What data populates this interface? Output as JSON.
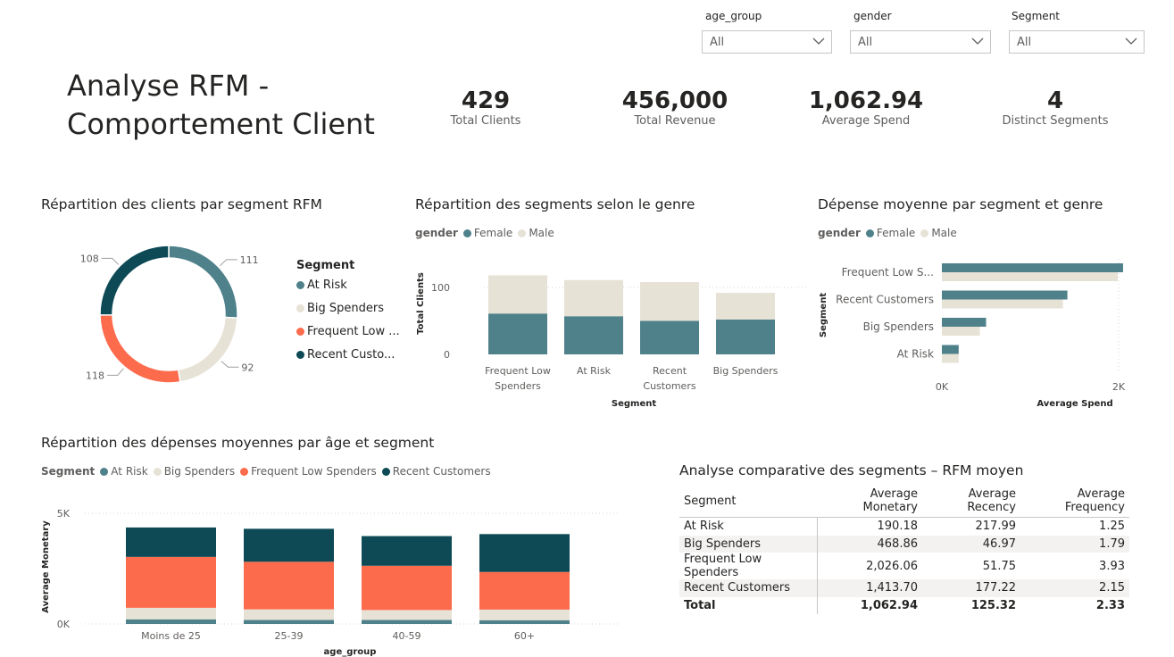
{
  "slicers": [
    {
      "label": "age_group",
      "value": "All"
    },
    {
      "label": "gender",
      "value": "All"
    },
    {
      "label": "Segment",
      "value": "All"
    }
  ],
  "title_line1": "Analyse RFM -",
  "title_line2": "Comportement Client",
  "kpis": [
    {
      "value": "429",
      "label": "Total Clients"
    },
    {
      "value": "456,000",
      "label": "Total Revenue"
    },
    {
      "value": "1,062.94",
      "label": "Average Spend"
    },
    {
      "value": "4",
      "label": "Distinct Segments"
    }
  ],
  "colors": {
    "at_risk": "#4f818b",
    "big_spenders": "#e6e2d6",
    "frequent_low": "#fd6b4d",
    "recent": "#0d4a56",
    "female": "#4f818b",
    "male": "#e6e2d6"
  },
  "donut": {
    "title": "Répartition des clients par segment RFM",
    "legend_title": "Segment",
    "legend_items": [
      "At Risk",
      "Big Spenders",
      "Frequent Low ...",
      "Recent Custo..."
    ]
  },
  "gender_bar": {
    "title": "Répartition des segments selon le genre",
    "legend_title": "gender",
    "legend_items": [
      "Female",
      "Male"
    ],
    "ylabel": "Total Clients",
    "xlabel": "Segment",
    "yticks": [
      "100",
      "0"
    ]
  },
  "spend_bar": {
    "title": "Dépense moyenne par segment et genre",
    "legend_title": "gender",
    "legend_items": [
      "Female",
      "Male"
    ],
    "ylabel": "Segment",
    "xlabel": "Average Spend",
    "xticks": [
      "0K",
      "2K"
    ]
  },
  "age_bar": {
    "title": "Répartition des dépenses moyennes par âge et segment",
    "legend_title": "Segment",
    "legend_items": [
      "At Risk",
      "Big Spenders",
      "Frequent Low Spenders",
      "Recent Customers"
    ],
    "ylabel": "Average Monetary",
    "xlabel": "age_group",
    "yticks": [
      "5K",
      "0K"
    ]
  },
  "table": {
    "title": "Analyse comparative des segments – RFM moyen",
    "headers": [
      "Segment",
      "Average Monetary",
      "Average Recency",
      "Average Frequency"
    ],
    "rows": [
      [
        "At Risk",
        "190.18",
        "217.99",
        "1.25"
      ],
      [
        "Big Spenders",
        "468.86",
        "46.97",
        "1.79"
      ],
      [
        "Frequent Low Spenders",
        "2,026.06",
        "51.75",
        "3.93"
      ],
      [
        "Recent Customers",
        "1,413.70",
        "177.22",
        "2.15"
      ]
    ],
    "total": [
      "Total",
      "1,062.94",
      "125.32",
      "2.33"
    ]
  },
  "chart_data": [
    {
      "type": "pie",
      "title": "Répartition des clients par segment RFM",
      "categories": [
        "At Risk",
        "Big Spenders",
        "Frequent Low Spenders",
        "Recent Customers"
      ],
      "values": [
        111,
        92,
        118,
        108
      ]
    },
    {
      "type": "bar",
      "title": "Répartition des segments selon le genre",
      "categories": [
        "Frequent Low Spenders",
        "At Risk",
        "Recent Customers",
        "Big Spenders"
      ],
      "category_labels": [
        [
          "Frequent Low",
          "Spenders"
        ],
        [
          "At Risk"
        ],
        [
          "Recent",
          "Customers"
        ],
        [
          "Big Spenders"
        ]
      ],
      "series": [
        {
          "name": "Female",
          "values": [
            61,
            57,
            50,
            52
          ]
        },
        {
          "name": "Male",
          "values": [
            57,
            54,
            58,
            40
          ]
        }
      ],
      "xlabel": "Segment",
      "ylabel": "Total Clients",
      "ylim": [
        0,
        120
      ]
    },
    {
      "type": "bar",
      "title": "Dépense moyenne par segment et genre",
      "categories": [
        "Frequent Low S...",
        "Recent Customers",
        "Big Spenders",
        "At Risk"
      ],
      "series": [
        {
          "name": "Female",
          "values": [
            2050,
            1420,
            500,
            190
          ]
        },
        {
          "name": "Male",
          "values": [
            1990,
            1370,
            430,
            190
          ]
        }
      ],
      "xlabel": "Average Spend",
      "ylabel": "Segment",
      "xlim": [
        0,
        2000
      ]
    },
    {
      "type": "bar",
      "title": "Répartition des dépenses moyennes par âge et segment",
      "categories": [
        "Moins de 25",
        "25-39",
        "40-59",
        "60+"
      ],
      "series": [
        {
          "name": "At Risk",
          "values": [
            210,
            180,
            180,
            170
          ]
        },
        {
          "name": "Big Spenders",
          "values": [
            520,
            480,
            450,
            480
          ]
        },
        {
          "name": "Frequent Low Spenders",
          "values": [
            2300,
            2150,
            2000,
            1700
          ]
        },
        {
          "name": "Recent Customers",
          "values": [
            1330,
            1490,
            1340,
            1710
          ]
        }
      ],
      "xlabel": "age_group",
      "ylabel": "Average Monetary",
      "ylim": [
        0,
        5000
      ]
    }
  ]
}
